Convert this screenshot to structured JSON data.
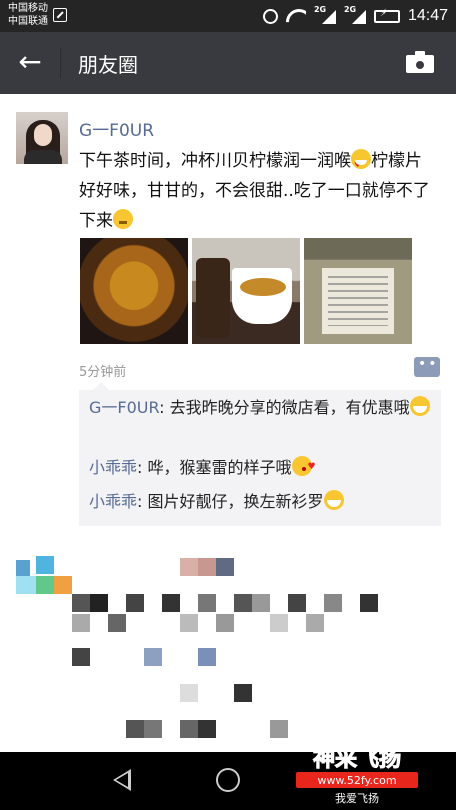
{
  "status_bar": {
    "carrier_1": "中国移动",
    "carrier_2": "中国联通",
    "network_1": "2G",
    "network_2": "2G",
    "time": "14:47",
    "icons": [
      "sim-icon",
      "alarm-icon",
      "wifi-icon",
      "signal-icon",
      "signal-icon",
      "battery-charging-icon"
    ]
  },
  "header": {
    "back_icon": "arrow-left-icon",
    "title": "朋友圈",
    "camera_icon": "camera-icon"
  },
  "post": {
    "author": "G一F0UR",
    "text_1": "下午茶时间，冲杯川贝柠檬润一润喉",
    "text_2": "柠檬片好好味，甘甘的，不会很甜..吃了一口就停不了下来",
    "photos": [
      "lemon-honey-slices",
      "tea-cup-and-jar",
      "labeled-jar"
    ],
    "time": "5分钟前",
    "comment_button_icon": "comment-icon",
    "comments": [
      {
        "author": "G一F0UR",
        "separator": ": ",
        "text": "去我昨晚分享的微店看，有优惠哦"
      },
      {
        "author": "小乖乖",
        "separator": ": ",
        "text": "哗，猴塞雷的样子哦"
      },
      {
        "author": "小乖乖",
        "separator": ": ",
        "text": "图片好靓仔，换左新衫罗"
      }
    ]
  },
  "watermark": {
    "title": "神采飞扬",
    "url": "www.52fy.com",
    "slogan": "我爱飞扬"
  },
  "colors": {
    "link": "#576b95",
    "header_bg": "#393a3f",
    "status_bg": "#252525",
    "watermark_red": "#e8261c"
  }
}
